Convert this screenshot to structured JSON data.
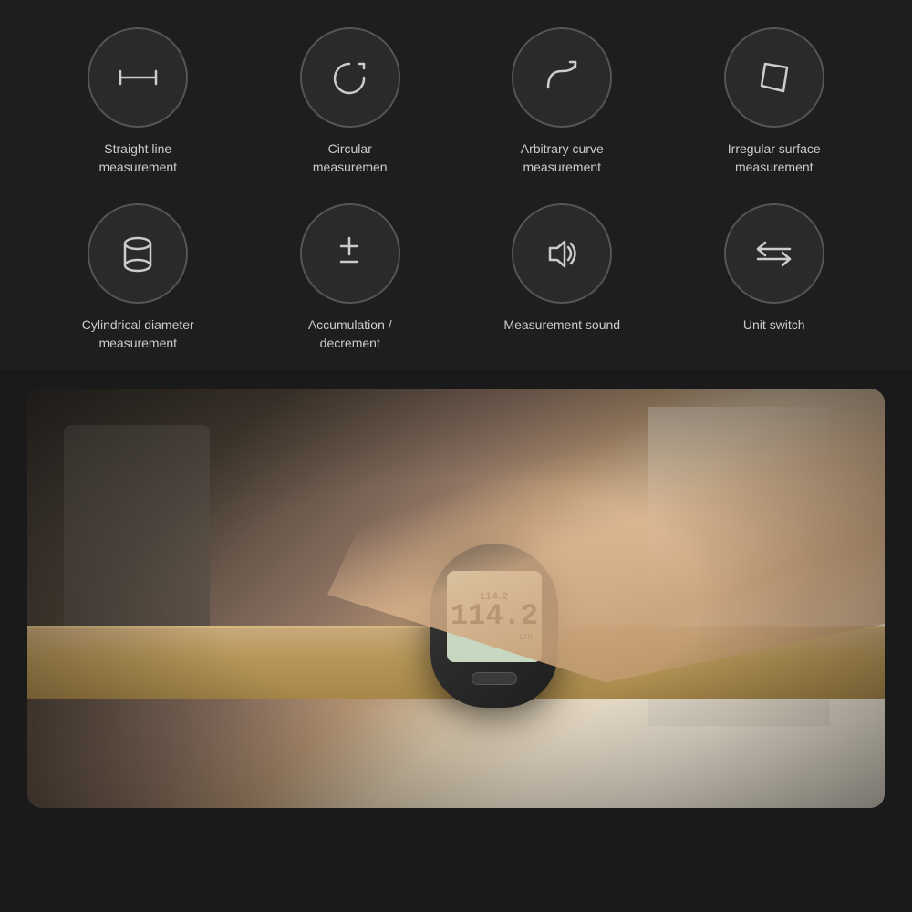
{
  "page": {
    "background": "#1e1e1e"
  },
  "icons_row1": [
    {
      "id": "straight-line",
      "label": "Straight line\nmeasurement",
      "label_display": "Straight line measurement"
    },
    {
      "id": "circular",
      "label": "Circular\nmeasuremen",
      "label_display": "Circular measuremen"
    },
    {
      "id": "arbitrary-curve",
      "label": "Arbitrary curve\nmeasurement",
      "label_display": "Arbitrary curve measurement"
    },
    {
      "id": "irregular-surface",
      "label": "Irregular surface\nmeasurement",
      "label_display": "Irregular surface measurement"
    }
  ],
  "icons_row2": [
    {
      "id": "cylindrical",
      "label": "Cylindrical\ndiameter\nmeasurement",
      "label_display": "Cylindrical diameter measurement"
    },
    {
      "id": "accumulation",
      "label": "Accumulation /\ndecrement",
      "label_display": "Accumulation / decrement"
    },
    {
      "id": "measurement-sound",
      "label": "Measurement\nsound",
      "label_display": "Measurement sound"
    },
    {
      "id": "unit-switch",
      "label": "Unit switch",
      "label_display": "Unit switch"
    }
  ],
  "device": {
    "screen_value": "114.2",
    "screen_value2": "114.2",
    "unit": "cm"
  }
}
